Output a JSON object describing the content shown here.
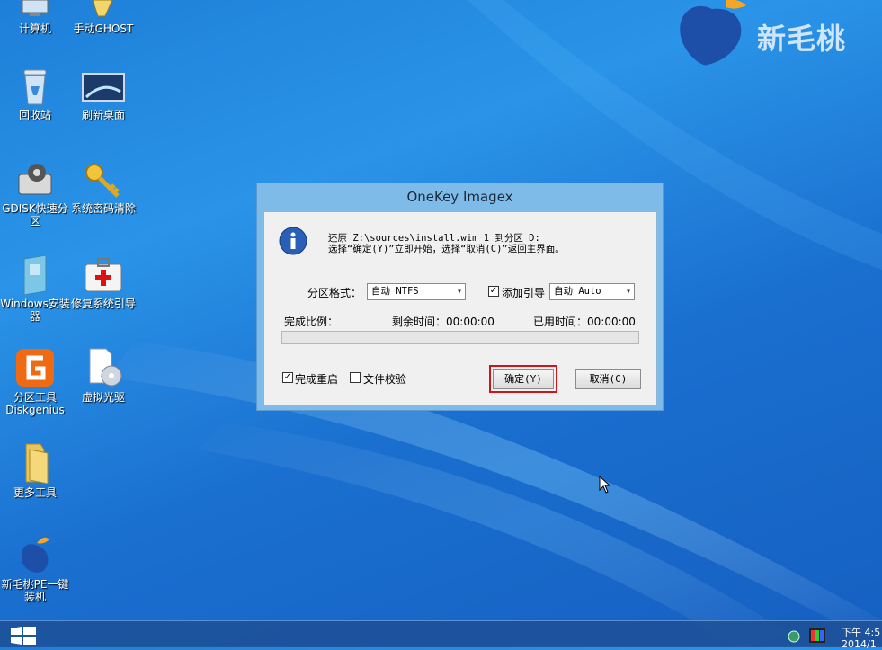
{
  "brand": {
    "name": "新毛桃"
  },
  "desktop_icons": [
    {
      "label": "计算机",
      "icon": "computer-icon"
    },
    {
      "label": "手动GHOST",
      "icon": "ghost-icon"
    },
    {
      "label": "回收站",
      "icon": "recycle-bin-icon"
    },
    {
      "label": "刷新桌面",
      "icon": "monitor-icon"
    },
    {
      "label": "GDISK快速分区",
      "icon": "gdisk-icon"
    },
    {
      "label": "系统密码清除",
      "icon": "key-icon"
    },
    {
      "label": "Windows安装器",
      "icon": "windows-installer-icon"
    },
    {
      "label": "修复系统引导",
      "icon": "first-aid-icon"
    },
    {
      "label": "分区工具Diskgenius",
      "icon": "diskgenius-icon"
    },
    {
      "label": "虚拟光驱",
      "icon": "virtual-drive-icon"
    },
    {
      "label": "更多工具",
      "icon": "folder-icon"
    },
    {
      "label": "新毛桃PE一键装机",
      "icon": "peach-icon"
    }
  ],
  "dialog": {
    "title": "OneKey Imagex",
    "message_line1": "还原 Z:\\sources\\install.wim 1 到分区 D:",
    "message_line2": "选择“确定(Y)”立即开始，选择“取消(C)”返回主界面。",
    "partition_format_label": "分区格式：",
    "partition_format_value": "自动 NTFS",
    "add_boot_label": "添加引导",
    "add_boot_checked": true,
    "boot_mode_value": "自动 Auto",
    "progress_label": "完成比例：",
    "remaining_time_label": "剩余时间：00:00:00",
    "elapsed_time_label": "已用时间：00:00:00",
    "progress_fraction": 0,
    "restart_label": "完成重启",
    "restart_checked": true,
    "verify_label": "文件校验",
    "verify_checked": false,
    "ok_button": "确定(Y)",
    "cancel_button": "取消(C)"
  },
  "taskbar": {
    "clock_line1": "下午 4:5",
    "clock_line2": "2014/1"
  }
}
